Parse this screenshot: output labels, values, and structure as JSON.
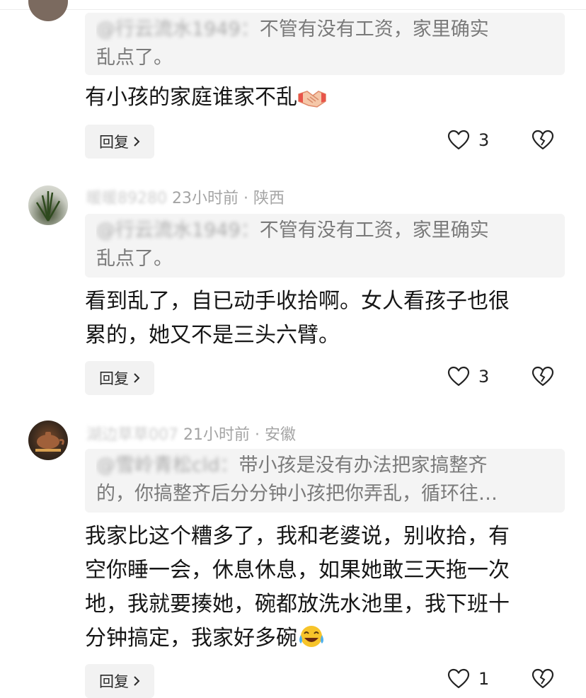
{
  "comments": [
    {
      "quote_user": "@行云流水1949：",
      "quote_lines": [
        "不管有没有工资，家里确实",
        "乱点了。"
      ],
      "body": "有小孩的家庭谁家不乱",
      "body_emoji": "handshake-emoji",
      "reply_label": "回复",
      "likes": "3"
    },
    {
      "username": "暖暖89280",
      "time": "23小时前",
      "separator": "·",
      "location": "陕西",
      "quote_user": "@行云流水1949：",
      "quote_lines": [
        "不管有没有工资，家里确实",
        "乱点了。"
      ],
      "body_lines": [
        "看到乱了，自已动手收拾啊。女人看孩子也很",
        "累的，她又不是三头六臂。"
      ],
      "reply_label": "回复",
      "likes": "3"
    },
    {
      "username": "湖边草草007",
      "time": "21小时前",
      "separator": "·",
      "location": "安徽",
      "quote_user": "@雪岭青松cld：",
      "quote_lines": [
        "带小孩是没有办法把家搞整齐",
        "的，你搞整齐后分分钟小孩把你弄乱，循环往…"
      ],
      "body_lines": [
        "我家比这个糟多了，我和老婆说，别收拾，有",
        "空你睡一会，休息休息，如果她敢三天拖一次",
        "地，我就要揍她，碗都放洗水池里，我下班十",
        "分钟搞定，我家好多碗"
      ],
      "body_emoji": "laughing-crying-emoji",
      "reply_label": "回复",
      "likes": "1"
    }
  ],
  "icons": {
    "like": "heart-outline-icon",
    "dislike": "broken-heart-icon",
    "reply_chevron": "chevron-right-icon"
  }
}
